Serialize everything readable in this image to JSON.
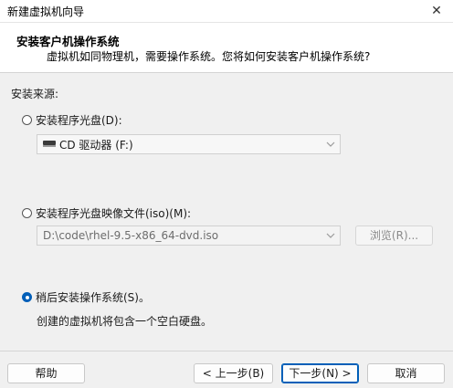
{
  "window": {
    "title": "新建虚拟机向导",
    "close_glyph": "✕"
  },
  "header": {
    "title": "安装客户机操作系统",
    "subtitle": "虚拟机如同物理机，需要操作系统。您将如何安装客户机操作系统?"
  },
  "source": {
    "label": "安装来源:",
    "options": [
      {
        "label": "安装程序光盘(D):",
        "selected": false,
        "value": "CD 驱动器 (F:)",
        "icon": "cd-drive-icon"
      },
      {
        "label": "安装程序光盘映像文件(iso)(M):",
        "selected": false,
        "value": "D:\\code\\rhel-9.5-x86_64-dvd.iso",
        "browse_label": "浏览(R)..."
      },
      {
        "label": "稍后安装操作系统(S)。",
        "selected": true,
        "description": "创建的虚拟机将包含一个空白硬盘。"
      }
    ]
  },
  "footer": {
    "help": "帮助",
    "back": "< 上一步(B)",
    "next": "下一步(N) >",
    "cancel": "取消"
  },
  "colors": {
    "accent": "#005fb8"
  }
}
